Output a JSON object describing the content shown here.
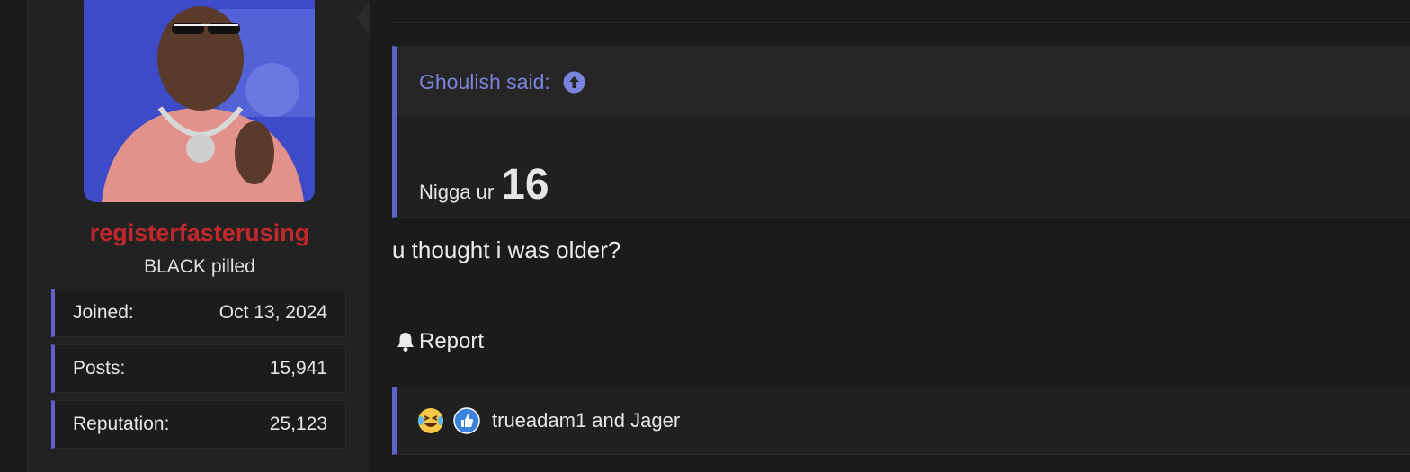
{
  "user": {
    "name": "registerfasterusing",
    "title": "BLACK pilled",
    "stats": [
      {
        "label": "Joined:",
        "value": "Oct 13, 2024"
      },
      {
        "label": "Posts:",
        "value": "15,941"
      },
      {
        "label": "Reputation:",
        "value": "25,123"
      }
    ]
  },
  "quote": {
    "author_said": "Ghoulish said:",
    "text": "Nigga ur",
    "big_text": "16"
  },
  "message": {
    "text": "u thought i was older?"
  },
  "actions": {
    "report_label": "Report"
  },
  "reactions": {
    "icons": [
      "laughing-crying-emoji-icon",
      "thumbs-up-icon"
    ],
    "names": "trueadam1 and Jager"
  },
  "colors": {
    "accent": "#5c63c8",
    "username": "#c0282b",
    "quote_link": "#7b84dc"
  }
}
